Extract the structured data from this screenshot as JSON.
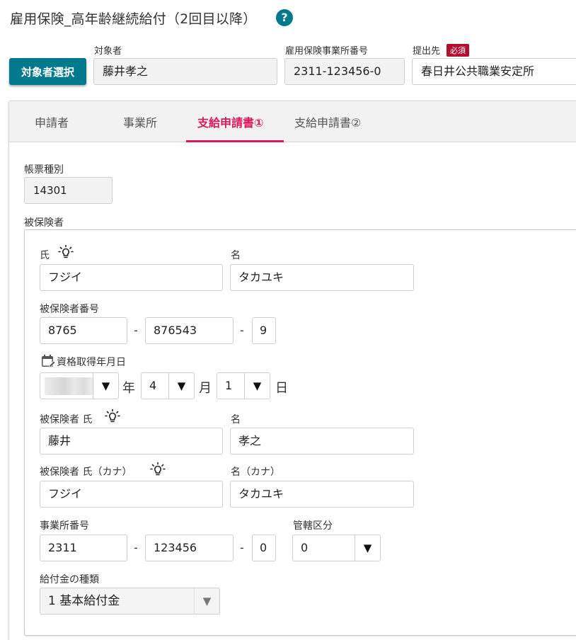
{
  "header": {
    "title": "雇用保険_高年齢継続給付（2回目以降）",
    "help_icon": "?",
    "select_button": "対象者選択",
    "target_label": "対象者",
    "target_value": "藤井孝之",
    "office_no_label": "雇用保険事業所番号",
    "office_no_value": "2311-123456-0",
    "submit_to_label": "提出先",
    "required_badge": "必須",
    "submit_to_value": "春日井公共職業安定所"
  },
  "tabs": [
    {
      "label": "申請者",
      "active": false
    },
    {
      "label": "事業所",
      "active": false
    },
    {
      "label": "支給申請書①",
      "active": true
    },
    {
      "label": "支給申請書②",
      "active": false
    }
  ],
  "form": {
    "form_type_label": "帳票種別",
    "form_type_value": "14301",
    "insured_section_label": "被保険者",
    "surname_label": "氏",
    "surname_value": "フジイ",
    "given_label": "名",
    "given_value": "タカユキ",
    "insured_no_label": "被保険者番号",
    "insured_no_1": "8765",
    "insured_no_2": "876543",
    "insured_no_3": "9",
    "dash": "-",
    "acquired_date_label": "資格取得年月日",
    "year_value": "",
    "year_unit": "年",
    "month_value": "4",
    "month_unit": "月",
    "day_value": "1",
    "day_unit": "日",
    "insured_surname_label": "被保険者 氏",
    "insured_surname_value": "藤井",
    "insured_given_label": "名",
    "insured_given_value": "孝之",
    "insured_surname_kana_label": "被保険者 氏（カナ）",
    "insured_surname_kana_value": "フジイ",
    "insured_given_kana_label": "名（カナ）",
    "insured_given_kana_value": "タカユキ",
    "office_no_label": "事業所番号",
    "office_no_1": "2311",
    "office_no_2": "123456",
    "office_no_3": "0",
    "jurisdiction_label": "管轄区分",
    "jurisdiction_value": "0",
    "benefit_type_label": "給付金の種類",
    "benefit_type_value": "1 基本給付金",
    "dropdown_arrow": "▼"
  },
  "colors": {
    "accent": "#00798c",
    "active_tab": "#d81b60",
    "required": "#b30d2f"
  },
  "icons": [
    "help-icon",
    "lightbulb-icon",
    "calendar-edit-icon",
    "chevron-down-icon"
  ]
}
